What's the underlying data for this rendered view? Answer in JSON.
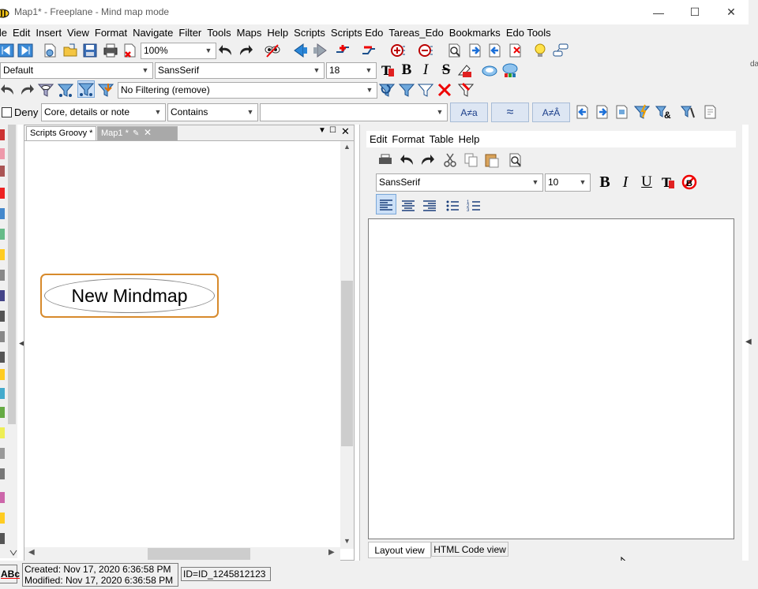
{
  "window": {
    "title": "Map1* - Freeplane - Mind map mode",
    "minimize_glyph": "—",
    "maximize_glyph": "☐",
    "close_glyph": "✕"
  },
  "menu": [
    "ile",
    "Edit",
    "Insert",
    "View",
    "Format",
    "Navigate",
    "Filter",
    "Tools",
    "Maps",
    "Help",
    "Scripts",
    "Scripts Edo",
    "Tareas_Edo",
    "Bookmarks",
    "Edo Tools"
  ],
  "toolbar1": {
    "zoom": "100%"
  },
  "toolbar2": {
    "style": "Default",
    "font": "SansSerif",
    "size": "18",
    "bold_glyph": "B",
    "italic_glyph": "I",
    "strike_glyph": "S"
  },
  "toolbar3": {
    "filter": "No Filtering (remove)"
  },
  "filterbar": {
    "deny_label": "Deny",
    "scope": "Core, details or note",
    "operator": "Contains",
    "value": "",
    "match_case": "A≠a",
    "approximate": "≈",
    "ignore_diacritics": "A≠Â"
  },
  "leftpanel": {
    "tabs": [
      "Scripts Groovy *",
      "Map1 *"
    ],
    "root_node": "New Mindmap"
  },
  "editor": {
    "menu": [
      "Edit",
      "Format",
      "Table",
      "Help"
    ],
    "font": "SansSerif",
    "size": "10",
    "bold_glyph": "B",
    "italic_glyph": "I",
    "underline_glyph": "U",
    "tabs": [
      "Layout view",
      "HTML Code view"
    ]
  },
  "status": {
    "abc": "ABc",
    "created": "Created: Nov 17, 2020 6:36:58 PM",
    "modified": "Modified: Nov 17, 2020 6:36:58 PM",
    "id": "ID=ID_1245812123"
  },
  "right_clip_text": "da"
}
